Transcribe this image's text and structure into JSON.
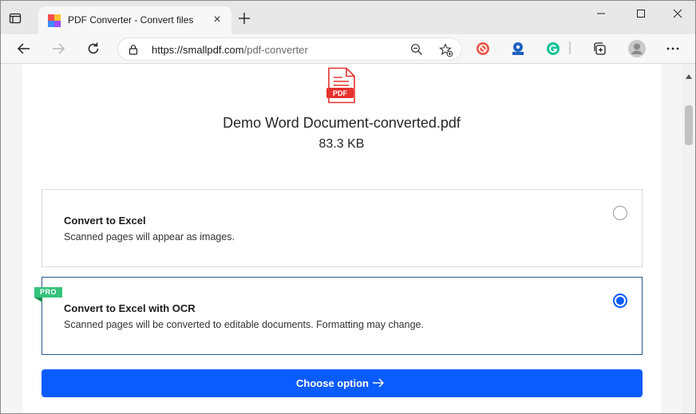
{
  "browser": {
    "tab": {
      "title": "PDF Converter - Convert files to a",
      "close_glyph": "×"
    },
    "url": {
      "host": "https://smallpdf.com",
      "path": "/pdf-converter"
    },
    "colors": {
      "accent": "#0b5cff",
      "pro": "#34c27a"
    }
  },
  "page": {
    "file_icon_label": "PDF",
    "file_name": "Demo Word Document-converted.pdf",
    "file_size": "83.3 KB",
    "options": [
      {
        "title": "Convert to Excel",
        "description": "Scanned pages will appear as images.",
        "selected": false
      },
      {
        "title": "Convert to Excel with OCR",
        "description": "Scanned pages will be converted to editable documents. Formatting may change.",
        "selected": true,
        "badge": "PRO"
      }
    ],
    "cta_label": "Choose option"
  },
  "icons": {
    "tab_actions": "tab-actions-icon",
    "favicon": "smallpdf-favicon",
    "new_tab": "plus-icon",
    "minimize": "minimize-icon",
    "maximize": "maximize-icon",
    "close": "close-icon",
    "back": "back-arrow-icon",
    "forward": "forward-arrow-icon",
    "refresh": "refresh-icon",
    "lock": "lock-icon",
    "zoom": "zoom-out-icon",
    "favorites": "add-favorite-icon"
  }
}
